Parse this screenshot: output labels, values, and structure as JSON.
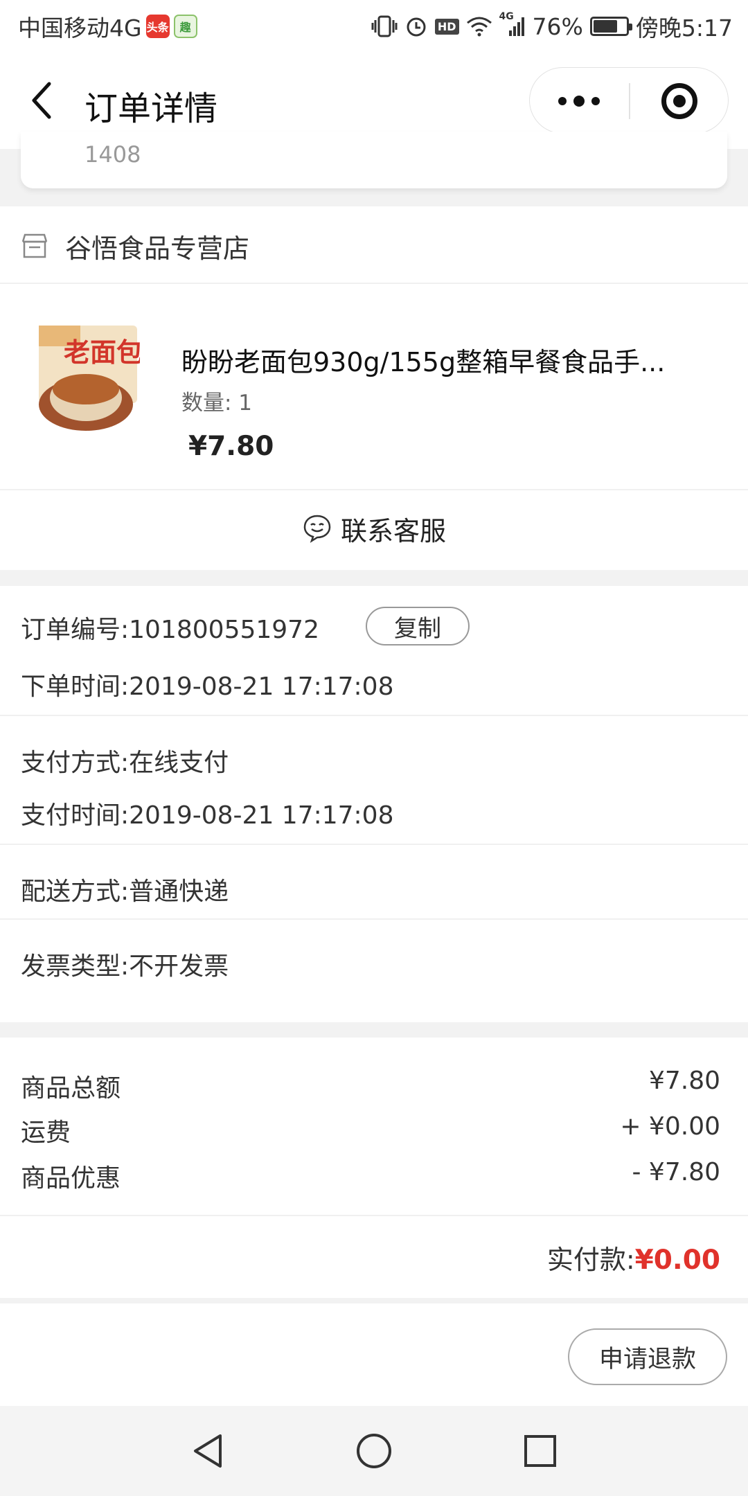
{
  "status_bar": {
    "carrier": "中国移动4G",
    "app_badge_1": "头条",
    "app_badge_2": "趣",
    "hd": "HD",
    "net": "4G",
    "battery": "76%",
    "battery_level": 0.76,
    "time": "傍晚5:17"
  },
  "nav": {
    "title": "订单详情"
  },
  "address": {
    "partial_text": "1408"
  },
  "store": {
    "name": "谷悟食品专营店"
  },
  "product": {
    "title": "盼盼老面包930g/155g整箱早餐食品手...",
    "quantity": "数量: 1",
    "price": "¥7.80"
  },
  "customer_service": {
    "label": "联系客服"
  },
  "order_info": {
    "order_no_label": "订单编号:",
    "order_no": "101800551972",
    "copy_label": "复制",
    "order_time_label": "下单时间:",
    "order_time": "2019-08-21 17:17:08",
    "pay_method_label": "支付方式:",
    "pay_method": "在线支付",
    "pay_time_label": "支付时间:",
    "pay_time": "2019-08-21 17:17:08",
    "delivery_label": "配送方式:",
    "delivery": "普通快递",
    "invoice_label": "发票类型:",
    "invoice": "不开发票"
  },
  "summary": {
    "goods_total_label": "商品总额",
    "goods_total": "¥7.80",
    "shipping_label": "运费",
    "shipping": "+ ¥0.00",
    "discount_label": "商品优惠",
    "discount": "- ¥7.80",
    "paid_label": "实付款:",
    "paid": "¥0.00"
  },
  "actions": {
    "refund_label": "申请退款"
  },
  "colors": {
    "accent_red": "#e0322b",
    "background": "#f2f2f2"
  }
}
